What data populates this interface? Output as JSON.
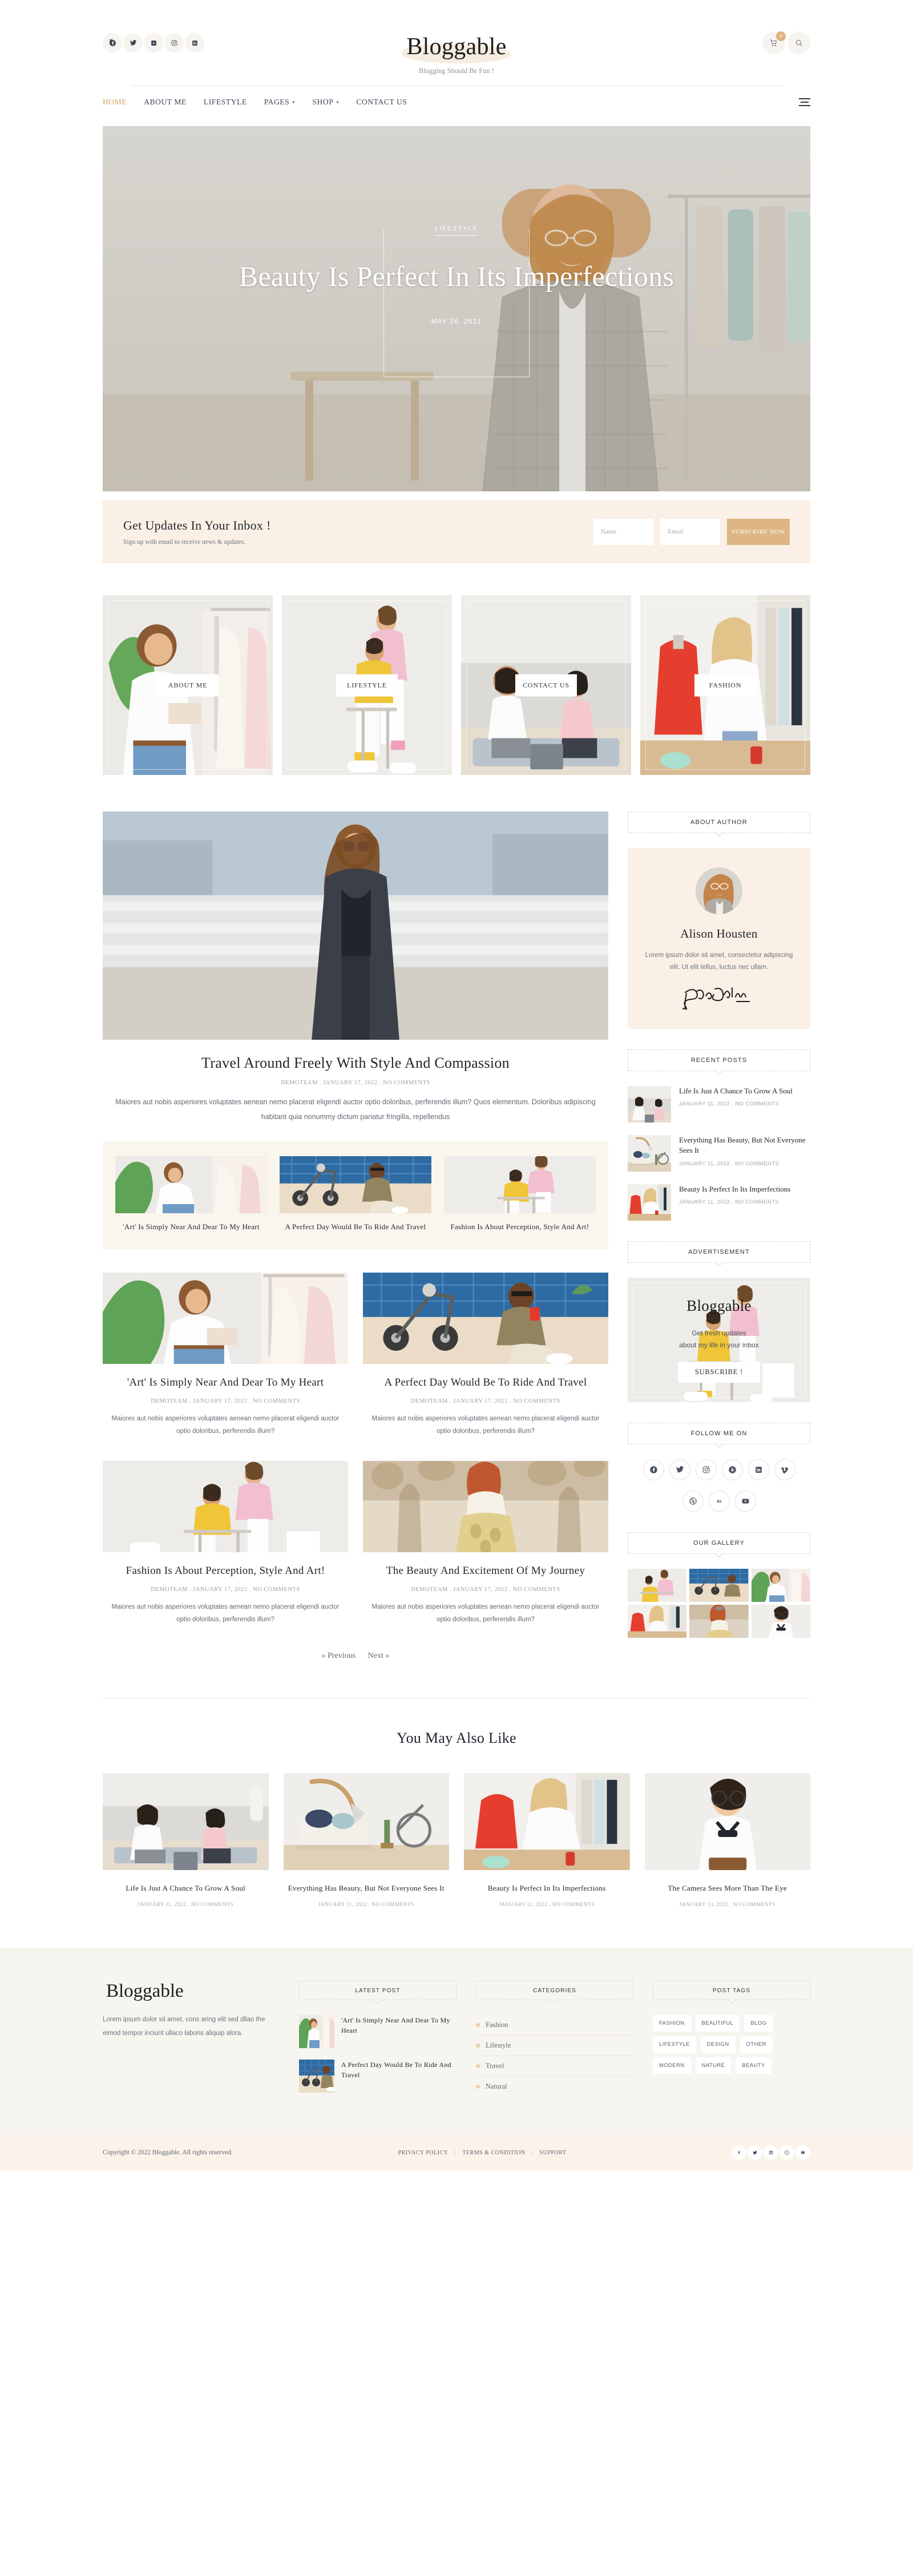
{
  "header": {
    "brand": "Bloggable",
    "tagline": "Blogging Should Be Fun !",
    "cart_count": "0",
    "social": [
      {
        "name": "facebook-icon",
        "label": "Facebook"
      },
      {
        "name": "twitter-icon",
        "label": "Twitter"
      },
      {
        "name": "vimeo-icon",
        "label": "Vimeo"
      },
      {
        "name": "instagram-icon",
        "label": "Instagram"
      },
      {
        "name": "linkedin-icon",
        "label": "LinkedIn"
      }
    ],
    "nav": [
      {
        "label": "HOME",
        "active": true,
        "caret": false
      },
      {
        "label": "ABOUT ME",
        "active": false,
        "caret": false
      },
      {
        "label": "LIFESTYLE",
        "active": false,
        "caret": false
      },
      {
        "label": "PAGES",
        "active": false,
        "caret": true
      },
      {
        "label": "SHOP",
        "active": false,
        "caret": true
      },
      {
        "label": "CONTACT US",
        "active": false,
        "caret": false
      }
    ]
  },
  "hero": {
    "category": "LIFESTYLE",
    "title": "Beauty Is Perfect In Its Imperfections",
    "date": "MAY 26, 2021"
  },
  "subscribe": {
    "heading": "Get Updates In Your Inbox !",
    "sub": "Sign up with email to receive news & updates.",
    "name_placeholder": "Name",
    "email_placeholder": "Email",
    "button": "SUBSCRIBE NOW",
    "accent": "#ddb684"
  },
  "tiles": [
    {
      "label": "ABOUT ME"
    },
    {
      "label": "LIFESTYLE"
    },
    {
      "label": "CONTACT US"
    },
    {
      "label": "FASHION"
    }
  ],
  "feature_post": {
    "title": "Travel Around Freely With Style And Compassion",
    "meta": "DEMOTEAM . JANUARY 17, 2022 . NO COMMENTS",
    "excerpt": "Maiores aut nobis asperiores voluptates aenean nemo placerat eligendi auctor optio doloribus, perferendis illum? Quos elementum. Doloribus adipiscing habitant quia nonummy dictum pariatur fringilla, repellendus"
  },
  "strip": [
    {
      "title": "'Art' Is Simply Near And Dear To My Heart"
    },
    {
      "title": "A Perfect Day Would Be To Ride And Travel"
    },
    {
      "title": "Fashion Is About Perception, Style And Art!"
    }
  ],
  "grid_posts": [
    {
      "title": "'Art' Is Simply Near And Dear To My Heart",
      "meta": "DEMOTEAM . JANUARY 17, 2022 . NO COMMENTS",
      "excerpt": "Maiores aut nobis asperiores voluptates aenean nemo placerat eligendi auctor optio doloribus, perferendis illum?"
    },
    {
      "title": "A Perfect Day Would Be To Ride And Travel",
      "meta": "DEMOTEAM . JANUARY 17, 2022 . NO COMMENTS",
      "excerpt": "Maiores aut nobis asperiores voluptates aenean nemo placerat eligendi auctor optio doloribus, perferendis illum?"
    },
    {
      "title": "Fashion Is About Perception, Style And Art!",
      "meta": "DEMOTEAM . JANUARY 17, 2022 . NO COMMENTS",
      "excerpt": "Maiores aut nobis asperiores voluptates aenean nemo placerat eligendi auctor optio doloribus, perferendis illum?"
    },
    {
      "title": "The Beauty And Excitement Of My Journey",
      "meta": "DEMOTEAM . JANUARY 17, 2022 . NO COMMENTS",
      "excerpt": "Maiores aut nobis asperiores voluptates aenean nemo placerat eligendi auctor optio doloribus, perferendis illum?"
    }
  ],
  "pagination": {
    "previous": "« Previous",
    "next": "Next »"
  },
  "sidebar": {
    "about_author": {
      "widget_title": "ABOUT AUTHOR",
      "name": "Alison Housten",
      "bio": "Lorem ipsum dolor sit amet, consectetur adipiscing elit. Ut elit tellus, luctus nec ullam."
    },
    "recent_posts": {
      "widget_title": "RECENT POSTS",
      "items": [
        {
          "title": "Life Is Just A Chance To Grow A Soul",
          "meta": "JANUARY 11, 2022 . NO COMMENTS"
        },
        {
          "title": "Everything Has Beauty, But Not Everyone Sees It",
          "meta": "JANUARY 11, 2022 . NO COMMENTS"
        },
        {
          "title": "Beauty Is Perfect In Its Imperfections",
          "meta": "JANUARY 11, 2022 . NO COMMENTS"
        }
      ]
    },
    "advertisement": {
      "widget_title": "ADVERTISEMENT",
      "brand": "Bloggable",
      "line1": "Get fresh updates",
      "line2": "about my life in your inbox",
      "button": "SUBSCRIBE !"
    },
    "follow": {
      "widget_title": "FOLLOW ME ON",
      "icons": [
        {
          "name": "facebook-icon"
        },
        {
          "name": "twitter-icon"
        },
        {
          "name": "instagram-icon"
        },
        {
          "name": "pinterest-icon"
        },
        {
          "name": "linkedin-icon"
        },
        {
          "name": "vimeo-icon"
        },
        {
          "name": "dribbble-icon"
        },
        {
          "name": "behance-icon"
        },
        {
          "name": "youtube-icon"
        }
      ]
    },
    "gallery": {
      "widget_title": "OUR GALLERY",
      "count": 6
    }
  },
  "you_may_also_like": {
    "heading": "You May Also Like",
    "items": [
      {
        "title": "Life Is Just A Chance To Grow A Soul",
        "meta": "JANUARY 11, 2022 . NO COMMENTS"
      },
      {
        "title": "Everything Has Beauty, But Not Everyone Sees It",
        "meta": "JANUARY 11, 2022 . NO COMMENTS"
      },
      {
        "title": "Beauty Is Perfect In Its Imperfections",
        "meta": "JANUARY 11, 2022 . NO COMMENTS"
      },
      {
        "title": "The Camera Sees More Than The Eye",
        "meta": "JANUARY 13, 2022 . NO COMMENTS"
      }
    ]
  },
  "footer": {
    "brand": "Bloggable",
    "desc": "Lorem ipsum dolor sit amet, cons aring elit sed dllao the eimod tempor inciunt ullaco laboris aliquip alora.",
    "latest_post": {
      "widget_title": "LATEST POST",
      "items": [
        {
          "title": "'Art' Is Simply Near And Dear To My Heart"
        },
        {
          "title": "A Perfect Day Would Be To Ride And Travel"
        }
      ]
    },
    "categories": {
      "widget_title": "CATEGORIES",
      "items": [
        "Fashion",
        "Lifestyle",
        "Travel",
        "Natural"
      ]
    },
    "post_tags": {
      "widget_title": "POST TAGS",
      "items": [
        "FASHION",
        "BEAUTIFUL",
        "BLOG",
        "LIFESTYLE",
        "DESIGN",
        "OTHER",
        "MODERN",
        "NATURE",
        "BEAUTY"
      ]
    },
    "copyright": "Copyright © 2022 Bloggable. All rights reserved.",
    "links": [
      "PRIVACY POLICY",
      "TERMS & CONDITION",
      "SUPPORT"
    ],
    "social": [
      {
        "name": "facebook-icon"
      },
      {
        "name": "twitter-icon"
      },
      {
        "name": "instagram-icon"
      },
      {
        "name": "pinterest-icon"
      },
      {
        "name": "youtube-icon"
      }
    ]
  }
}
